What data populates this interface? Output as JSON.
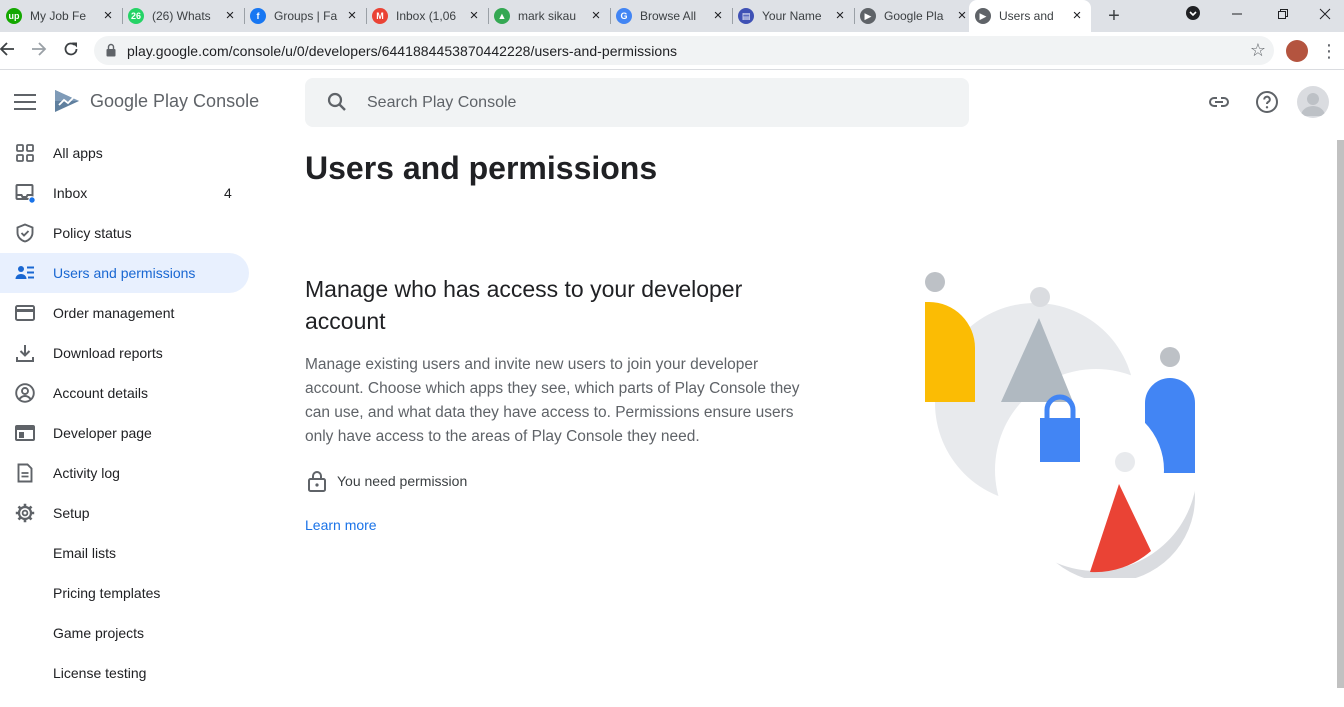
{
  "browser": {
    "tabs": [
      {
        "label": "My Job Fe",
        "favicon": "upwork-icon",
        "fav_text": "up",
        "fav_color": "#14a800"
      },
      {
        "label": "(26) Whats",
        "favicon": "whatsapp-icon",
        "fav_text": "26",
        "fav_color": "#25d366"
      },
      {
        "label": "Groups | Fa",
        "favicon": "facebook-icon",
        "fav_text": "f",
        "fav_color": "#1877f2"
      },
      {
        "label": "Inbox (1,06",
        "favicon": "gmail-icon",
        "fav_text": "M",
        "fav_color": "#ea4335"
      },
      {
        "label": "mark sikau",
        "favicon": "drive-icon",
        "fav_text": "▲",
        "fav_color": "#34a853"
      },
      {
        "label": "Browse All",
        "favicon": "google-icon",
        "fav_text": "G",
        "fav_color": "#4285f4"
      },
      {
        "label": "Your Name",
        "favicon": "forms-icon",
        "fav_text": "▤",
        "fav_color": "#3f51b5"
      },
      {
        "label": "Google Pla",
        "favicon": "play-console-icon",
        "fav_text": "▶",
        "fav_color": "#5f6368"
      },
      {
        "label": "Users and",
        "favicon": "play-console-icon",
        "fav_text": "▶",
        "fav_color": "#5f6368",
        "active": true
      }
    ],
    "new_tab_glyph": "+",
    "url": "play.google.com/console/u/0/developers/6441884453870442228/users-and-permissions"
  },
  "header": {
    "brand": "Google Play Console",
    "search_placeholder": "Search Play Console"
  },
  "sidebar": {
    "items": [
      {
        "label": "All apps",
        "icon": "grid-icon"
      },
      {
        "label": "Inbox",
        "icon": "inbox-icon",
        "count": "4"
      },
      {
        "label": "Policy status",
        "icon": "shield-icon"
      },
      {
        "label": "Users and permissions",
        "icon": "users-icon",
        "active": true
      },
      {
        "label": "Order management",
        "icon": "credit-card-icon"
      },
      {
        "label": "Download reports",
        "icon": "download-icon"
      },
      {
        "label": "Account details",
        "icon": "account-circle-icon"
      },
      {
        "label": "Developer page",
        "icon": "web-page-icon"
      },
      {
        "label": "Activity log",
        "icon": "document-icon"
      },
      {
        "label": "Setup",
        "icon": "gear-icon"
      },
      {
        "label": "Email lists"
      },
      {
        "label": "Pricing templates"
      },
      {
        "label": "Game projects"
      },
      {
        "label": "License testing"
      }
    ]
  },
  "main": {
    "title": "Users and permissions",
    "section_title": "Manage who has access to your developer account",
    "section_body": "Manage existing users and invite new users to join your developer account. Choose which apps they see, which parts of Play Console they can use, and what data they have access to. Permissions ensure users only have access to the areas of Play Console they need.",
    "permission_text": "You need permission",
    "learn_more": "Learn more"
  },
  "colors": {
    "accent": "#1a73e8",
    "active_bg": "#e8f0fe",
    "illus_yellow": "#fbbc04",
    "illus_blue": "#4285f4",
    "illus_red": "#ea4335",
    "illus_grey": "#dadce0"
  }
}
